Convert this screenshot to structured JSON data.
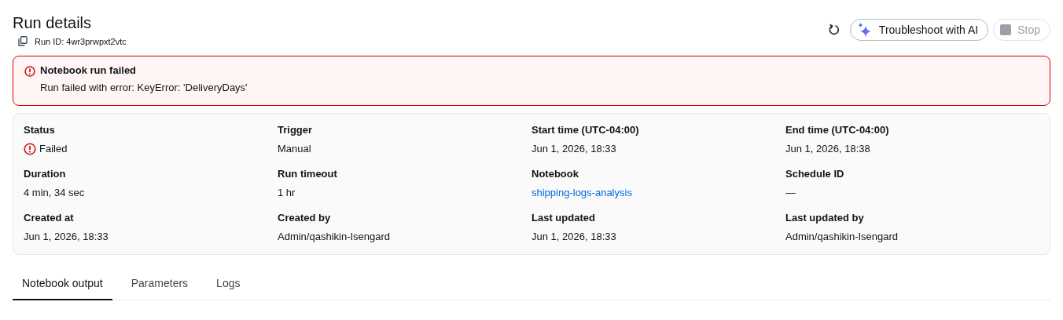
{
  "header": {
    "title": "Run details",
    "run_id": "Run ID: 4wr3prwpxt2vtc"
  },
  "actions": [
    {
      "kind": "refresh"
    },
    {
      "kind": "ai",
      "label": "Troubleshoot with AI",
      "disabled": false
    },
    {
      "kind": "stop",
      "label": "Stop",
      "disabled": true
    }
  ],
  "alert": {
    "title": "Notebook run failed",
    "message": "Run failed with error: KeyError: 'DeliveryDays'"
  },
  "details": [
    {
      "label": "Status",
      "kind": "error",
      "value": "Failed"
    },
    {
      "label": "Trigger",
      "kind": "text",
      "value": "Manual"
    },
    {
      "label": "Start time (UTC-04:00)",
      "kind": "text",
      "value": "Jun 1, 2026, 18:33"
    },
    {
      "label": "End time (UTC-04:00)",
      "kind": "text",
      "value": "Jun 1, 2026, 18:38"
    },
    {
      "label": "Duration",
      "kind": "text",
      "value": "4 min, 34 sec"
    },
    {
      "label": "Run timeout",
      "kind": "text",
      "value": "1 hr"
    },
    {
      "label": "Notebook",
      "kind": "link",
      "value": "shipping-logs-analysis"
    },
    {
      "label": "Schedule ID",
      "kind": "text",
      "value": "—"
    },
    {
      "label": "Created at",
      "kind": "text",
      "value": "Jun 1, 2026, 18:33"
    },
    {
      "label": "Created by",
      "kind": "text",
      "value": "Admin/qashikin-Isengard"
    },
    {
      "label": "Last updated",
      "kind": "text",
      "value": "Jun 1, 2026, 18:33"
    },
    {
      "label": "Last updated by",
      "kind": "text",
      "value": "Admin/qashikin-Isengard"
    }
  ],
  "tabs": [
    {
      "label": "Notebook output",
      "selected": true
    },
    {
      "label": "Parameters",
      "selected": false
    },
    {
      "label": "Logs",
      "selected": false
    }
  ]
}
